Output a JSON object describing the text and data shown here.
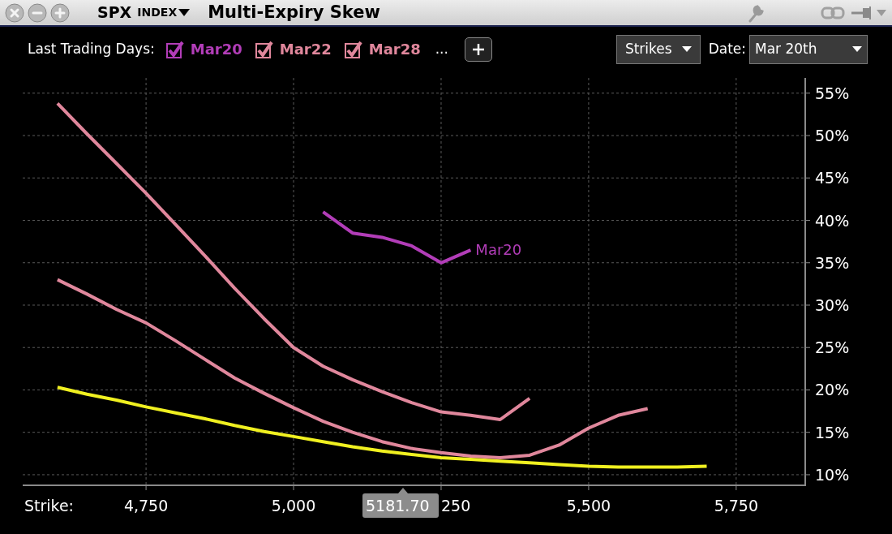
{
  "window": {
    "symbol": "SPX",
    "symbol_suffix": "INDEX",
    "title": "Multi-Expiry Skew"
  },
  "toolbar": {
    "label": "Last Trading Days:",
    "expiries": [
      {
        "label": "Mar20",
        "checked": true,
        "color": "#b23db8"
      },
      {
        "label": "Mar22",
        "checked": true,
        "color": "#e0879c"
      },
      {
        "label": "Mar28",
        "checked": true,
        "color": "#e0879c"
      }
    ],
    "more": "...",
    "axis_dropdown": "Strikes",
    "date_label": "Date:",
    "date_dropdown": "Mar 20th"
  },
  "chart": {
    "crosshair_label": "5181.70",
    "partly_covered_tick_label": "250",
    "chart_data": {
      "type": "line",
      "xlabel": "Strike:",
      "x": [
        4600,
        4650,
        4700,
        4750,
        4800,
        4850,
        4900,
        4950,
        5000,
        5050,
        5100,
        5150,
        5200,
        5250,
        5300,
        5350,
        5400,
        5450,
        5500,
        5550,
        5600,
        5650,
        5700
      ],
      "series": [
        {
          "name": "Mar20",
          "color": "#b23db8",
          "values": [
            null,
            null,
            null,
            null,
            null,
            null,
            null,
            null,
            null,
            41,
            38.5,
            38,
            37,
            35,
            36.5,
            null,
            null,
            null,
            null,
            null,
            null,
            null,
            null
          ]
        },
        {
          "color": "#e0879c",
          "values": [
            53.8,
            50.2,
            46.7,
            43.2,
            39.5,
            35.8,
            32,
            28.4,
            25,
            22.8,
            21.2,
            19.8,
            18.5,
            17.4,
            17,
            16.5,
            19,
            null,
            null,
            null,
            null,
            null,
            null
          ]
        },
        {
          "color": "#e0879c",
          "values": [
            33,
            31.3,
            29.5,
            27.9,
            25.8,
            23.6,
            21.4,
            19.6,
            17.9,
            16.3,
            15,
            13.9,
            13.1,
            12.6,
            12.2,
            12,
            12.3,
            13.5,
            15.5,
            17,
            17.8,
            null,
            null
          ]
        },
        {
          "color": "#f0f020",
          "values": [
            20.3,
            19.5,
            18.8,
            18,
            17.3,
            16.6,
            15.8,
            15.1,
            14.5,
            13.9,
            13.3,
            12.8,
            12.4,
            12,
            11.8,
            11.6,
            11.4,
            11.2,
            11,
            10.9,
            10.9,
            10.9,
            11
          ]
        }
      ],
      "grid": true,
      "xlim": [
        4541,
        5867
      ],
      "ylim": [
        8.75,
        56.8
      ],
      "xticks": [
        {
          "value": 4750,
          "label": "4,750"
        },
        {
          "value": 5000,
          "label": "5,000"
        },
        {
          "value": 5500,
          "label": "5,500"
        },
        {
          "value": 5750,
          "label": "5,750"
        }
      ],
      "yticks": [
        {
          "value": 10,
          "label": "10%"
        },
        {
          "value": 15,
          "label": "15%"
        },
        {
          "value": 20,
          "label": "20%"
        },
        {
          "value": 25,
          "label": "25%"
        },
        {
          "value": 30,
          "label": "30%"
        },
        {
          "value": 35,
          "label": "35%"
        },
        {
          "value": 40,
          "label": "40%"
        },
        {
          "value": 45,
          "label": "45%"
        },
        {
          "value": 50,
          "label": "50%"
        },
        {
          "value": 55,
          "label": "55%"
        }
      ]
    }
  }
}
